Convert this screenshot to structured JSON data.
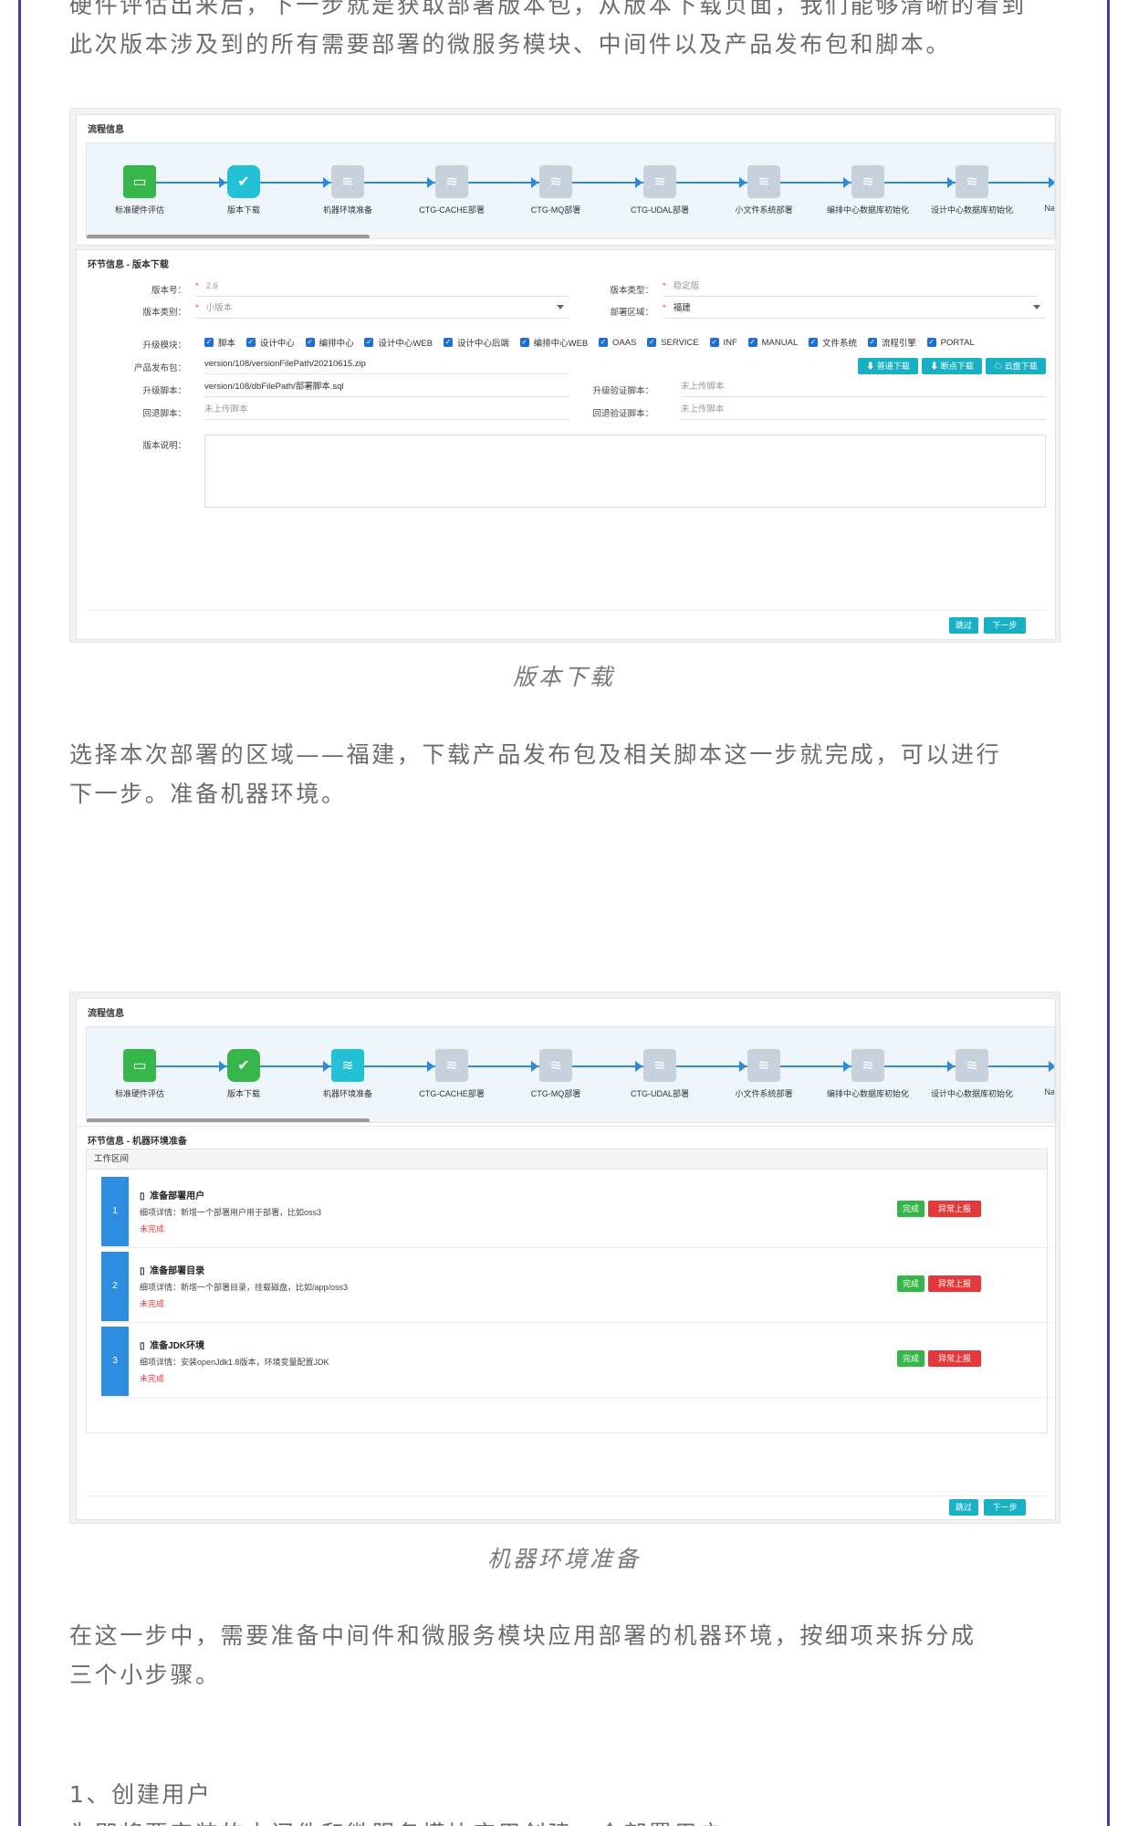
{
  "article": {
    "para_top_line1": "硬件评估出来后，下一步就是获取部署版本包，从版本下载页面，我们能够清晰的看到",
    "para_top_line2": "此次版本涉及到的所有需要部署的微服务模块、中间件以及产品发布包和脚本。",
    "caption1": "版本下载",
    "para2_line1": "选择本次部署的区域——福建，下载产品发布包及相关脚本这一步就完成，可以进行",
    "para2_line2": "下一步。准备机器环境。",
    "caption2": "机器环境准备",
    "para3_line1": "在这一步中，需要准备中间件和微服务模块应用部署的机器环境，按细项来拆分成",
    "para3_line2": "三个小步骤。",
    "para4_line1": "1、创建用户",
    "para4_line2": "为即将要安装的中间件和微服务模块应用创建一个部署用户"
  },
  "flow": {
    "title": "流程信息",
    "nodes": [
      {
        "label": "标准硬件评估",
        "icon": "hardware-icon"
      },
      {
        "label": "版本下载",
        "icon": "check-icon"
      },
      {
        "label": "机器环境准备",
        "icon": "layers-icon"
      },
      {
        "label": "CTG-CACHE部署",
        "icon": "layers-icon"
      },
      {
        "label": "CTG-MQ部署",
        "icon": "layers-icon"
      },
      {
        "label": "CTG-UDAL部署",
        "icon": "layers-icon"
      },
      {
        "label": "小文件系统部署",
        "icon": "layers-icon"
      },
      {
        "label": "编排中心数据库初始化",
        "icon": "layers-icon"
      },
      {
        "label": "设计中心数据库初始化",
        "icon": "layers-icon"
      },
      {
        "label": "Nacc",
        "icon": "layers-icon"
      }
    ]
  },
  "download": {
    "section_title": "环节信息 - 版本下载",
    "version_no_label": "版本号：",
    "version_no": "2.6",
    "version_type_label": "版本类型：",
    "version_type": "稳定版",
    "version_cat_label": "版本类别：",
    "version_cat": "小版本",
    "region_label": "部署区域：",
    "region": "福建",
    "modules_label": "升级模块：",
    "modules": [
      "脚本",
      "设计中心",
      "编排中心",
      "设计中心WEB",
      "设计中心后端",
      "编排中心WEB",
      "OAAS",
      "SERVICE",
      "INF",
      "MANUAL",
      "文件系统",
      "流程引擎",
      "PORTAL"
    ],
    "package_label": "产品发布包：",
    "package": "version/108/versionFilePath/20210615.zip",
    "upgrade_script_label": "升级脚本：",
    "upgrade_script": "version/108/dbFilePath/部署脚本.sql",
    "upgrade_verify_label": "升级验证脚本：",
    "upgrade_verify": "未上传脚本",
    "rollback_label": "回退脚本：",
    "rollback": "未上传脚本",
    "rollback_verify_label": "回退验证脚本：",
    "rollback_verify": "未上传脚本",
    "desc_label": "版本说明：",
    "btn_normal": "普通下载",
    "btn_resume": "断点下载",
    "btn_cloud": "云盘下载",
    "btn_skip": "跳过",
    "btn_next": "下一步"
  },
  "machine": {
    "section_title": "环节信息 - 机器环境准备",
    "workspace": "工作区间",
    "tasks": [
      {
        "num": "1",
        "title": "准备部署用户",
        "detail": "细项详情：新增一个部署用户用于部署，比如oss3",
        "status": "未完成"
      },
      {
        "num": "2",
        "title": "准备部署目录",
        "detail": "细项详情：新增一个部署目录，挂载磁盘，比如/app/oss3",
        "status": "未完成"
      },
      {
        "num": "3",
        "title": "准备JDK环境",
        "detail": "细项详情：安装openJdk1.8版本，环境变量配置JDK",
        "status": "未完成"
      }
    ],
    "box_glyph": "▯",
    "btn_done": "完成",
    "btn_report": "异常上报",
    "btn_skip": "跳过",
    "btn_next": "下一步"
  }
}
